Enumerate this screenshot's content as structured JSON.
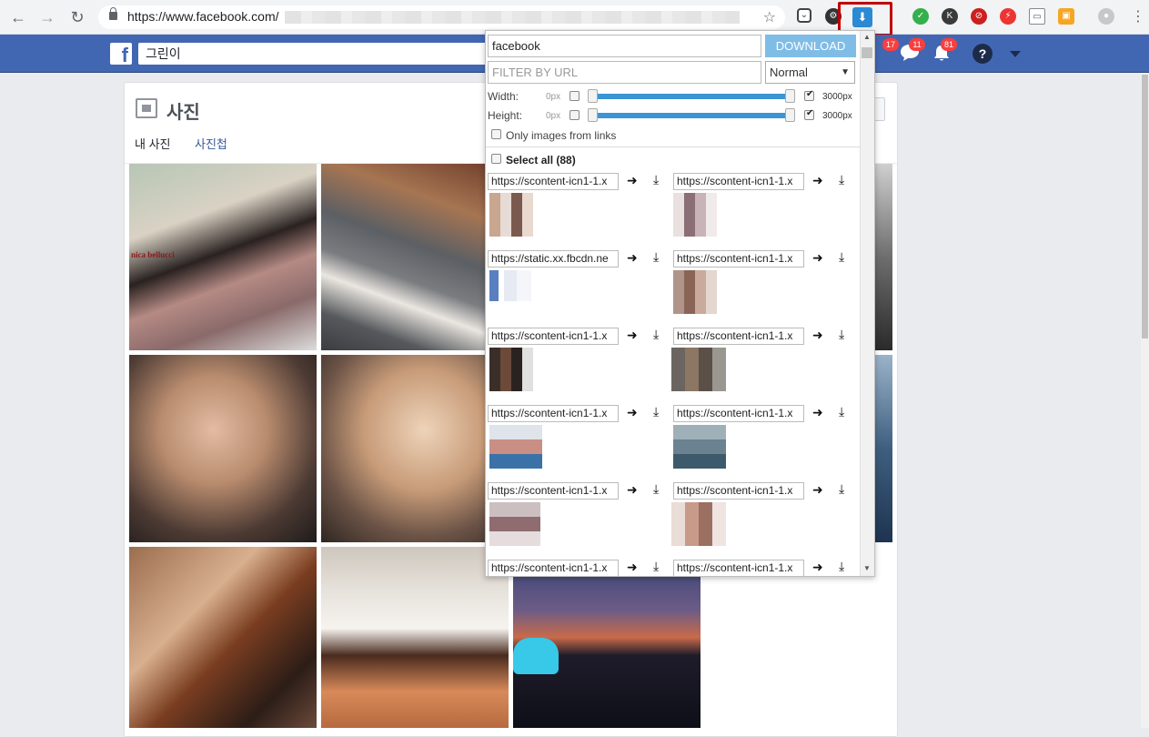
{
  "browser": {
    "url": "https://www.facebook.com/",
    "back_icon": "back-arrow-icon",
    "forward_icon": "forward-arrow-icon",
    "reload_icon": "reload-icon"
  },
  "facebook": {
    "logo": "f",
    "search_value": "그린이",
    "badges": {
      "friends": "17",
      "messages": "11",
      "notifications": "81"
    },
    "help": "?"
  },
  "photos_card": {
    "title": "사진",
    "tabs": [
      "내 사진",
      "사진첩"
    ]
  },
  "photo_thumbs": {
    "photo1_caption": "nica bellucci"
  },
  "popup": {
    "search_value": "facebook",
    "download_label": "DOWNLOAD",
    "filter_placeholder": "FILTER BY URL",
    "mode_value": "Normal",
    "width_label": "Width:",
    "height_label": "Height:",
    "min_px": "0px",
    "max_px": "3000px",
    "only_links_label": "Only images from links",
    "select_all_label": "Select all (88)",
    "rows": [
      {
        "left_url": "https://scontent-icn1-1.x",
        "right_url": "https://scontent-icn1-1.x"
      },
      {
        "left_url": "https://static.xx.fbcdn.ne",
        "right_url": "https://scontent-icn1-1.x"
      },
      {
        "left_url": "https://scontent-icn1-1.x",
        "right_url": "https://scontent-icn1-1.x"
      },
      {
        "left_url": "https://scontent-icn1-1.x",
        "right_url": "https://scontent-icn1-1.x"
      },
      {
        "left_url": "https://scontent-icn1-1.x",
        "right_url": "https://scontent-icn1-1.x"
      },
      {
        "left_url": "https://scontent-icn1-1.x",
        "right_url": "https://scontent-icn1-1.x"
      }
    ]
  },
  "colors": {
    "fb_blue": "#4267b2",
    "slider_blue": "#3b95d4",
    "download_button": "#7fbde6",
    "highlight_red": "#c00000"
  }
}
